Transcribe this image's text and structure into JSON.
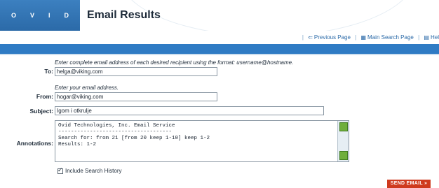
{
  "header": {
    "logo_letters": [
      "O",
      "V",
      "I",
      "D"
    ],
    "title": "Email Results"
  },
  "nav": {
    "previous_page": "Previous Page",
    "main_search_page": "Main Search Page",
    "help": "Hel"
  },
  "form": {
    "to": {
      "label": "To:",
      "hint": "Enter complete email address of each desired recipient using the format: username@hostname.",
      "value": "helga@viking.com"
    },
    "from": {
      "label": "From:",
      "hint": "Enter your email address.",
      "value": "hogar@viking.com"
    },
    "subject": {
      "label": "Subject:",
      "value": "Igom i otkrulje"
    },
    "annotations": {
      "label": "Annotations:",
      "lines": [
        "Ovid Technologies, Inc. Email Service",
        "------------------------------------",
        "Search for: from 21 [from 20 keep 1-10] keep 1-2",
        "Results: 1-2"
      ]
    },
    "include_history": "Include Search History",
    "send_button": "SEND EMAIL"
  },
  "colors": {
    "brand_blue": "#2f7bc4",
    "send_red": "#cf3a1e",
    "scroll_green": "#6fae3c"
  }
}
